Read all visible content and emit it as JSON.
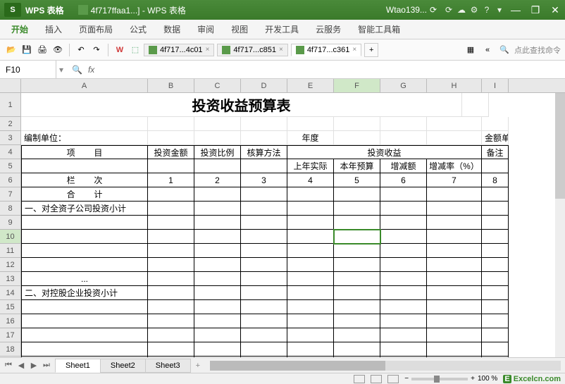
{
  "titlebar": {
    "logo": "S",
    "app_name": "WPS 表格",
    "doc_title": "4f717ffaa1...] - WPS 表格",
    "user": "Wtao139...",
    "winbtns": {
      "min": "—",
      "restore": "❐",
      "close": "✕"
    }
  },
  "menu": {
    "items": [
      "开始",
      "插入",
      "页面布局",
      "公式",
      "数据",
      "审阅",
      "视图",
      "开发工具",
      "云服务",
      "智能工具箱"
    ],
    "active_index": 0
  },
  "toolbar": {
    "icons": {
      "open": "📂",
      "save": "💾",
      "print": "🖨",
      "preview": "👁",
      "undo": "↶",
      "redo": "↷",
      "wps": "W",
      "cube": "⬚"
    },
    "doctabs": [
      {
        "label": "4f717...4c01",
        "close": "×",
        "active": false
      },
      {
        "label": "4f717...c851",
        "close": "×",
        "active": false
      },
      {
        "label": "4f717...c361",
        "close": "×",
        "active": true
      }
    ],
    "plus": "+",
    "right": {
      "ruler": "▦",
      "collapse": "«",
      "search_icon": "🔍",
      "search_hint": "点此查找命令"
    }
  },
  "formulabar": {
    "cellref": "F10",
    "dropdown": "▾",
    "search_icon": "🔍",
    "fx": "fx",
    "value": ""
  },
  "columns": [
    "A",
    "B",
    "C",
    "D",
    "E",
    "F",
    "G",
    "H",
    "I"
  ],
  "selected_col": "F",
  "selected_row": 10,
  "sheet": {
    "title": "投资收益预算表",
    "row3": {
      "a": "编制单位：",
      "e": "年度",
      "i": "金额单位："
    },
    "row4": {
      "a": "项",
      "a2": "目",
      "b": "投资金额",
      "c": "投资比例",
      "d": "核算方法",
      "efgh": "投资收益",
      "i": "备注"
    },
    "row5": {
      "e": "上年实际",
      "f": "本年预算",
      "g": "增减额",
      "h": "增减率（%）"
    },
    "row6": {
      "a": "栏",
      "a2": "次",
      "b": "1",
      "c": "2",
      "d": "3",
      "e": "4",
      "f": "5",
      "g": "6",
      "h": "7",
      "i": "8"
    },
    "row7": {
      "a": "合",
      "a2": "计"
    },
    "row8": {
      "a": "一、对全资子公司投资小计"
    },
    "row13": {
      "a": "..."
    },
    "row14": {
      "a": "二、对控股企业投资小计"
    }
  },
  "sheettabs": {
    "nav": {
      "first": "⏮",
      "prev": "◀",
      "next": "▶",
      "last": "⏭"
    },
    "tabs": [
      "Sheet1",
      "Sheet2",
      "Sheet3"
    ],
    "active_index": 0,
    "add": "+"
  },
  "statusbar": {
    "zoom_out": "−",
    "zoom_in": "+",
    "zoom_pct": "100 %",
    "brand": "Excelcn.com"
  }
}
